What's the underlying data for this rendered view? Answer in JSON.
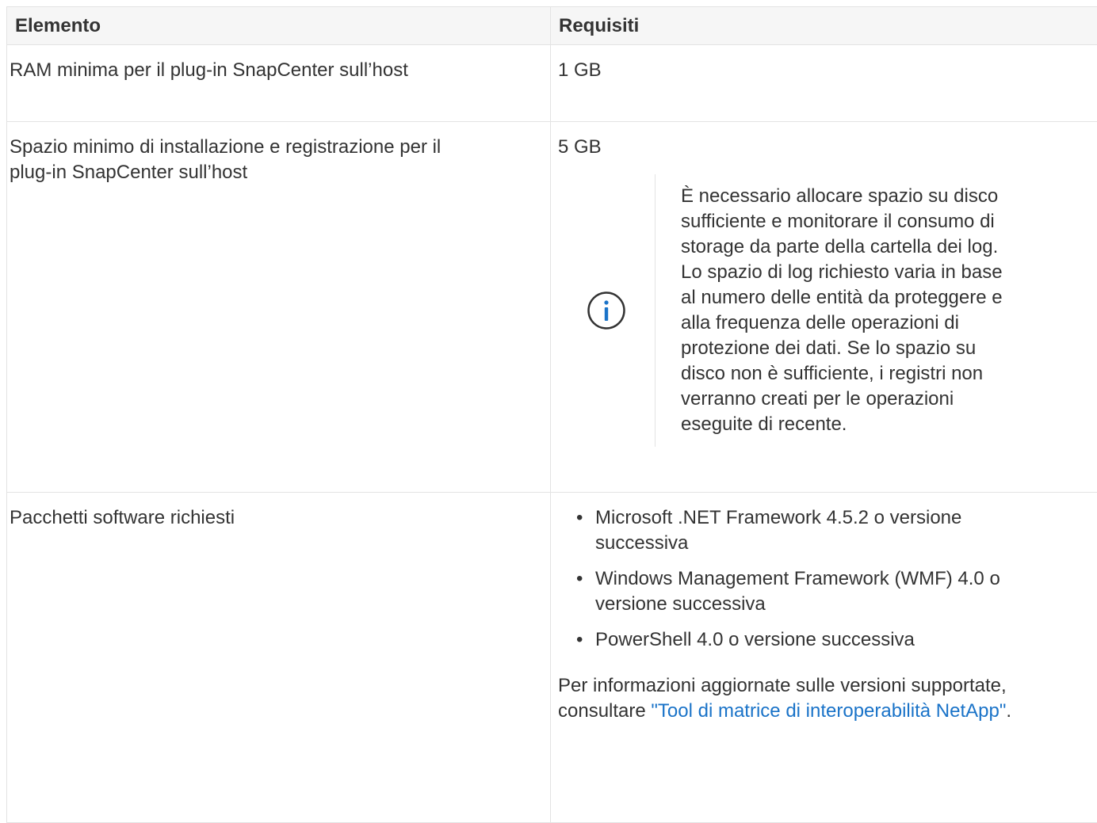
{
  "table": {
    "headers": {
      "element": "Elemento",
      "requirements": "Requisiti"
    },
    "rows": [
      {
        "element": "RAM minima per il plug-in SnapCenter sull’host",
        "requirement": "1 GB"
      },
      {
        "element_lines": [
          "Spazio minimo di installazione e registrazione per il",
          "plug-in SnapCenter sull’host"
        ],
        "requirement": "5 GB",
        "note": {
          "icon": "info-circle-icon",
          "lines": [
            "È necessario allocare spazio su disco",
            "sufficiente e monitorare il consumo di",
            "storage da parte della cartella dei log.",
            "Lo spazio di log richiesto varia in base",
            "al numero delle entità da proteggere e",
            "alla frequenza delle operazioni di",
            "protezione dei dati. Se lo spazio su",
            "disco non è sufficiente, i registri non",
            "verranno creati per le operazioni",
            "eseguite di recente."
          ]
        }
      },
      {
        "element": "Pacchetti software richiesti",
        "bullets": [
          [
            "Microsoft .NET Framework 4.5.2 o versione",
            "successiva"
          ],
          [
            "Windows Management Framework (WMF) 4.0 o",
            "versione successiva"
          ],
          [
            "PowerShell 4.0 o versione successiva"
          ]
        ],
        "footer": {
          "line1": "Per informazioni aggiornate sulle versioni supportate,",
          "line2_prefix": "consultare ",
          "link": "\"Tool di matrice di interoperabilità NetApp\"",
          "line2_suffix": "."
        }
      }
    ]
  },
  "colors": {
    "text": "#333333",
    "link": "#1a73c8",
    "header_bg": "#f6f6f6",
    "border": "#e3e3e3"
  }
}
